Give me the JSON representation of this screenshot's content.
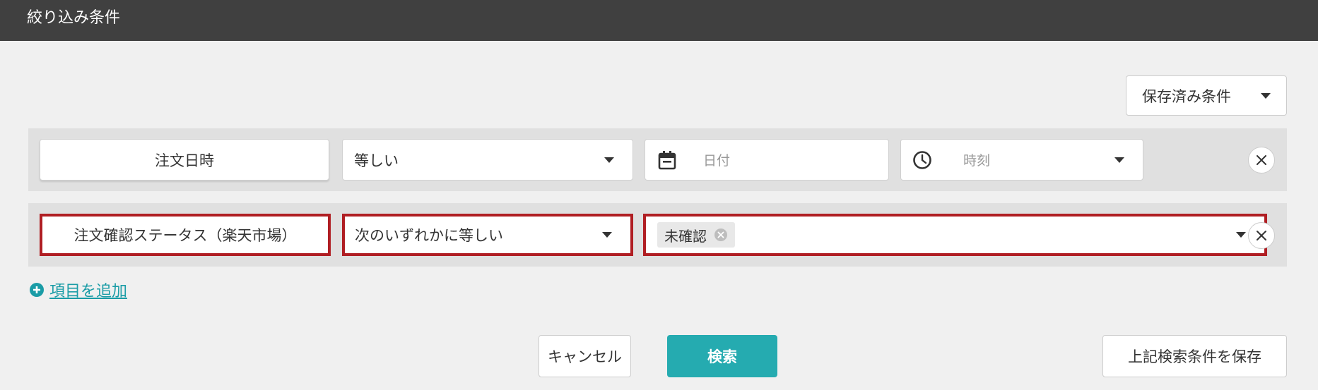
{
  "header": {
    "title": "絞り込み条件"
  },
  "saved_conditions": {
    "label": "保存済み条件"
  },
  "rows": [
    {
      "field": "注文日時",
      "operator": "等しい",
      "date_placeholder": "日付",
      "time_placeholder": "時刻"
    },
    {
      "field": "注文確認ステータス（楽天市場）",
      "operator": "次のいずれかに等しい",
      "chip": "未確認"
    }
  ],
  "add_item": {
    "label": "項目を追加"
  },
  "actions": {
    "cancel": "キャンセル",
    "search": "検索",
    "save": "上記検索条件を保存"
  },
  "colors": {
    "header_bg": "#404040",
    "accent": "#25abb0",
    "link": "#1a9ca6",
    "highlight": "#b01e23"
  },
  "icons": [
    "calendar-icon",
    "clock-icon",
    "close-icon",
    "plus-circle-icon",
    "chevron-down-icon"
  ]
}
